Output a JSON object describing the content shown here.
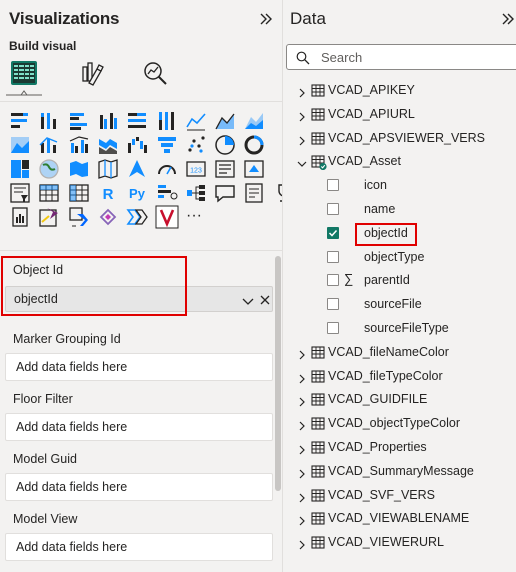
{
  "visualizations": {
    "title": "Visualizations",
    "build_visual_label": "Build visual",
    "modes": [
      "build-visual",
      "format-visual",
      "analytics"
    ],
    "icon_rows": [
      [
        "stacked-bar-chart",
        "stacked-column-chart",
        "clustered-bar-chart",
        "clustered-column-chart",
        "100-stacked-bar-chart",
        "100-stacked-column-chart",
        "line-chart",
        "area-chart",
        "stacked-area-chart"
      ],
      [
        "100-stacked-area-chart",
        "line-and-stacked-column-chart",
        "line-and-clustered-column-chart",
        "ribbon-chart",
        "waterfall-chart",
        "funnel-chart",
        "scatter-chart",
        "pie-chart",
        "donut-chart"
      ],
      [
        "treemap",
        "map",
        "filled-map",
        "azure-map",
        "arcgis-map",
        "gauge",
        "card",
        "multi-row-card",
        "kpi"
      ],
      [
        "slicer",
        "table",
        "matrix",
        "r-script-visual",
        "python-visual",
        "key-influencers",
        "decomposition-tree",
        "qa",
        "smart-narrative",
        "goals"
      ],
      [
        "paginated-report",
        "power-apps",
        "power-automate",
        "custom-visual-1",
        "custom-visual-2",
        "vcad-visual",
        "more-visuals"
      ]
    ],
    "more_label": "···",
    "wells": [
      {
        "label": "Object Id",
        "field": "objectId"
      },
      {
        "label": "Marker Grouping Id",
        "placeholder": "Add data fields here"
      },
      {
        "label": "Floor Filter",
        "placeholder": "Add data fields here"
      },
      {
        "label": "Model Guid",
        "placeholder": "Add data fields here"
      },
      {
        "label": "Model View",
        "placeholder": "Add data fields here"
      }
    ]
  },
  "data": {
    "title": "Data",
    "search_placeholder": "Search",
    "tables_before": [
      "VCAD_APIKEY",
      "VCAD_APIURL",
      "VCAD_APSVIEWER_VERS"
    ],
    "expanded_table": {
      "name": "VCAD_Asset",
      "fields": [
        {
          "name": "icon",
          "checked": false,
          "sigma": false
        },
        {
          "name": "name",
          "checked": false,
          "sigma": false
        },
        {
          "name": "objectId",
          "checked": true,
          "sigma": false
        },
        {
          "name": "objectType",
          "checked": false,
          "sigma": false
        },
        {
          "name": "parentId",
          "checked": false,
          "sigma": true
        },
        {
          "name": "sourceFile",
          "checked": false,
          "sigma": false
        },
        {
          "name": "sourceFileType",
          "checked": false,
          "sigma": false
        }
      ]
    },
    "tables_after": [
      "VCAD_fileNameColor",
      "VCAD_fileTypeColor",
      "VCAD_GUIDFILE",
      "VCAD_objectTypeColor",
      "VCAD_Properties",
      "VCAD_SummaryMessage",
      "VCAD_SVF_VERS",
      "VCAD_VIEWABLENAME",
      "VCAD_VIEWERURL"
    ]
  },
  "colors": {
    "accent": "#117865",
    "highlight": "#e00000",
    "pane_bg": "#f3f2f1",
    "icon_blue": "#118dff",
    "icon_dark": "#252423"
  },
  "sigma_symbol": "∑"
}
